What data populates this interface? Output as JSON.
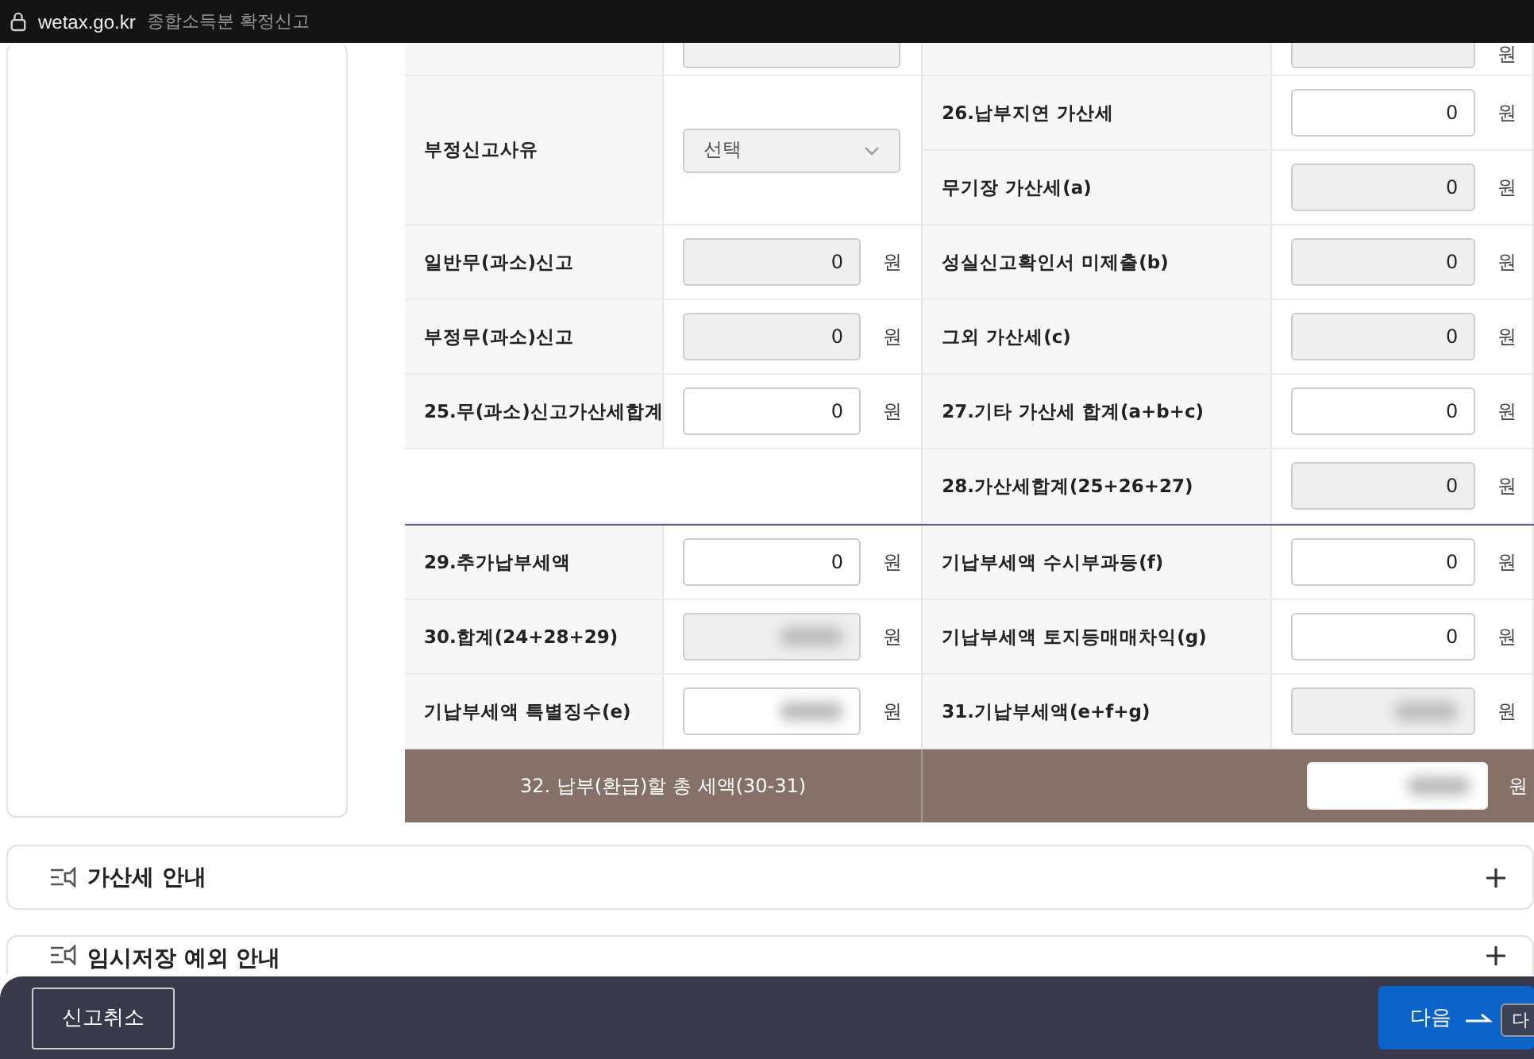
{
  "browser_bar": {
    "domain": "wetax.go.kr",
    "page_title": "종합소득분 확정신고"
  },
  "sections": [
    {
      "left": [
        {
          "kind": "partial",
          "field": {
            "kind": "select"
          }
        },
        {
          "kind": "tall",
          "label": "부정신고사유",
          "field": {
            "kind": "select",
            "value": "선택"
          }
        },
        {
          "kind": "row",
          "label": "일반무(과소)신고",
          "field": {
            "kind": "readonly",
            "value": "0",
            "unit": "원"
          }
        },
        {
          "kind": "row",
          "label": "부정무(과소)신고",
          "field": {
            "kind": "readonly",
            "value": "0",
            "unit": "원"
          }
        },
        {
          "kind": "row",
          "label": "25.무(과소)신고가산세합계",
          "field": {
            "kind": "input",
            "value": "0",
            "unit": "원"
          }
        },
        {
          "kind": "empty"
        }
      ],
      "right": [
        {
          "kind": "partial",
          "field": {
            "kind": "readonly",
            "unit": "원"
          }
        },
        {
          "kind": "row",
          "label": "26.납부지연 가산세",
          "field": {
            "kind": "input",
            "value": "0",
            "unit": "원"
          }
        },
        {
          "kind": "row",
          "label": "무기장 가산세(a)",
          "field": {
            "kind": "readonly",
            "value": "0",
            "unit": "원"
          }
        },
        {
          "kind": "row",
          "label": "성실신고확인서 미제출(b)",
          "field": {
            "kind": "readonly",
            "value": "0",
            "unit": "원"
          }
        },
        {
          "kind": "row",
          "label": "그외 가산세(c)",
          "field": {
            "kind": "readonly",
            "value": "0",
            "unit": "원"
          }
        },
        {
          "kind": "row",
          "label": "27.기타 가산세 합계(a+b+c)",
          "field": {
            "kind": "input",
            "value": "0",
            "unit": "원"
          }
        },
        {
          "kind": "row",
          "label": "28.가산세합계(25+26+27)",
          "field": {
            "kind": "readonly",
            "value": "0",
            "unit": "원"
          }
        }
      ]
    },
    {
      "left": [
        {
          "kind": "row",
          "label": "29.추가납부세액",
          "field": {
            "kind": "input",
            "value": "0",
            "unit": "원"
          }
        },
        {
          "kind": "row",
          "label": "30.합계(24+28+29)",
          "field": {
            "kind": "readonly",
            "redacted": true,
            "unit": "원"
          }
        },
        {
          "kind": "row",
          "label": "기납부세액 특별징수(e)",
          "field": {
            "kind": "input",
            "redacted": true,
            "unit": "원"
          }
        }
      ],
      "right": [
        {
          "kind": "row",
          "label": "기납부세액 수시부과등(f)",
          "field": {
            "kind": "input",
            "value": "0",
            "unit": "원"
          }
        },
        {
          "kind": "row",
          "label": "기납부세액 토지등매매차익(g)",
          "field": {
            "kind": "input",
            "value": "0",
            "unit": "원"
          }
        },
        {
          "kind": "row",
          "label": "31.기납부세액(e+f+g)",
          "field": {
            "kind": "readonly",
            "redacted": true,
            "unit": "원"
          }
        }
      ]
    }
  ],
  "total": {
    "label": "32. 납부(환급)할 총 세액(30-31)",
    "field": {
      "kind": "input",
      "redacted": true,
      "unit": "원"
    }
  },
  "accordions": [
    {
      "title": "가산세 안내",
      "expanded": false
    },
    {
      "title": "임시저장 예외 안내",
      "expanded": false
    }
  ],
  "footer": {
    "cancel": "신고취소",
    "next": "다음",
    "peek": "다"
  }
}
